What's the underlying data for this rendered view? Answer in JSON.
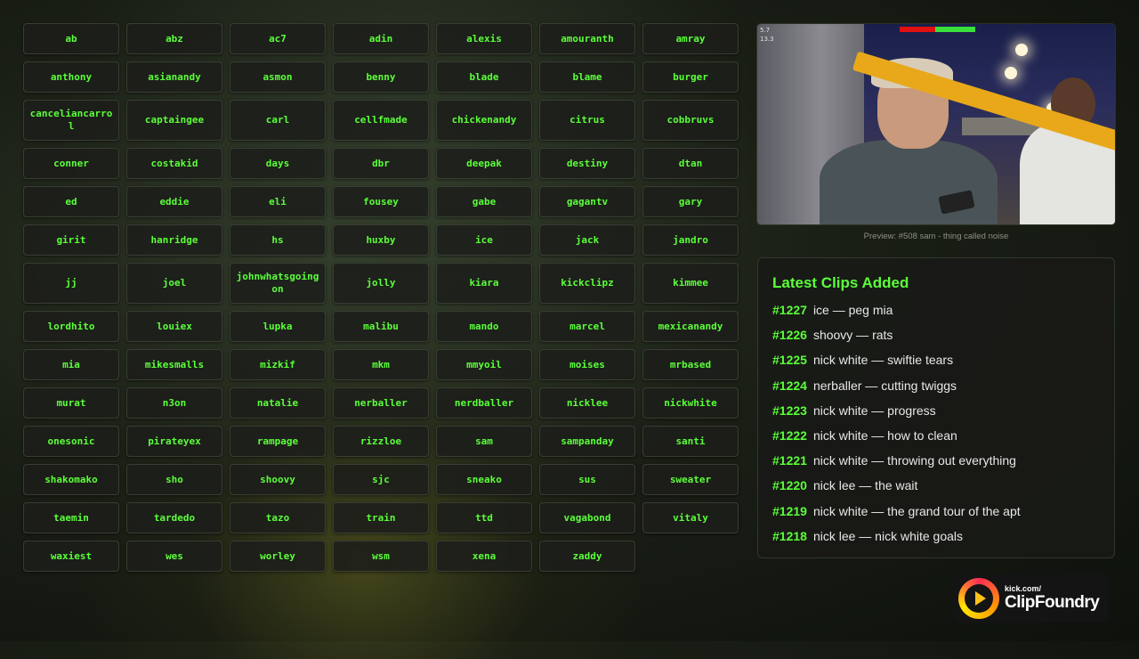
{
  "streamers": [
    "ab",
    "abz",
    "ac7",
    "adin",
    "alexis",
    "amouranth",
    "amray",
    "anthony",
    "asianandy",
    "asmon",
    "benny",
    "blade",
    "blame",
    "burger",
    "canceliancarrol",
    "captaingee",
    "carl",
    "cellfmade",
    "chickenandy",
    "citrus",
    "cobbruvs",
    "conner",
    "costakid",
    "days",
    "dbr",
    "deepak",
    "destiny",
    "dtan",
    "ed",
    "eddie",
    "eli",
    "fousey",
    "gabe",
    "gagantv",
    "gary",
    "girit",
    "hanridge",
    "hs",
    "huxby",
    "ice",
    "jack",
    "jandro",
    "jj",
    "joel",
    "johnwhatsgoingon",
    "jolly",
    "kiara",
    "kickclipz",
    "kimmee",
    "lordhito",
    "louiex",
    "lupka",
    "malibu",
    "mando",
    "marcel",
    "mexicanandy",
    "mia",
    "mikesmalls",
    "mizkif",
    "mkm",
    "mmyoil",
    "moises",
    "mrbased",
    "murat",
    "n3on",
    "natalie",
    "nerballer",
    "nerdballer",
    "nicklee",
    "nickwhite",
    "onesonic",
    "pirateyex",
    "rampage",
    "rizzloe",
    "sam",
    "sampanday",
    "santi",
    "shakomako",
    "sho",
    "shoovy",
    "sjc",
    "sneako",
    "sus",
    "sweater",
    "taemin",
    "tardedo",
    "tazo",
    "train",
    "ttd",
    "vagabond",
    "vitaly",
    "waxiest",
    "wes",
    "worley",
    "wsm",
    "xena",
    "zaddy"
  ],
  "preview": {
    "caption": "Preview: #508 sam - thing called noise",
    "hud": {
      "stat1": "5.7",
      "stat2": "13.3"
    }
  },
  "latest": {
    "title": "Latest Clips Added",
    "items": [
      {
        "num": "#1227",
        "text": "ice — peg mia"
      },
      {
        "num": "#1226",
        "text": "shoovy — rats"
      },
      {
        "num": "#1225",
        "text": "nick white — swiftie tears"
      },
      {
        "num": "#1224",
        "text": "nerballer — cutting twiggs"
      },
      {
        "num": "#1223",
        "text": "nick white — progress"
      },
      {
        "num": "#1222",
        "text": "nick white — how to clean"
      },
      {
        "num": "#1221",
        "text": "nick white — throwing out everything"
      },
      {
        "num": "#1220",
        "text": "nick lee — the wait"
      },
      {
        "num": "#1219",
        "text": "nick white — the grand tour of the apt"
      },
      {
        "num": "#1218",
        "text": "nick lee — nick white goals"
      }
    ]
  },
  "logo": {
    "small": "kick.com/",
    "big": "ClipFoundry"
  },
  "colors": {
    "accent": "#5bff3a",
    "panel": "#1c1e1a"
  }
}
